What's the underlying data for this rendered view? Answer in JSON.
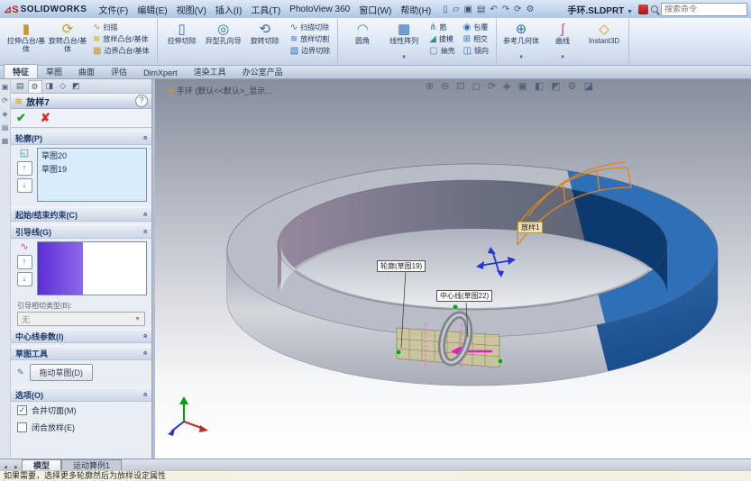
{
  "titlebar": {
    "logo": "SOLIDWORKS",
    "menus": [
      "文件(F)",
      "编辑(E)",
      "视图(V)",
      "插入(I)",
      "工具(T)",
      "PhotoView 360",
      "窗口(W)",
      "帮助(H)"
    ],
    "doc_title": "手环.SLDPRT",
    "search_placeholder": "搜索命令"
  },
  "quick_icons": [
    "▯",
    "▱",
    "▣",
    "▤",
    "↶",
    "↷",
    "⟳",
    "⚙"
  ],
  "ribbon": {
    "extrude_boss": "拉伸凸台/基体",
    "revolve_boss": "旋转凸台/基体",
    "sweep": "扫描",
    "loft": "放样凸台/基体",
    "boundary": "边界凸台/基体",
    "extrude_cut": "拉伸切除",
    "hole_wizard": "异型孔向导",
    "revolve_cut": "旋转切除",
    "sweep_cut": "扫描切除",
    "loft_cut": "放样切割",
    "boundary_cut": "边界切除",
    "fillet": "圆角",
    "linear_pattern": "线性阵列",
    "rib": "筋",
    "draft": "拔模",
    "shell": "抽壳",
    "wrap": "包覆",
    "intersect": "相交",
    "mirror": "镜向",
    "ref_geometry": "参考几何体",
    "curves": "曲线",
    "instant3d": "Instant3D"
  },
  "ribbon_icons": {
    "extrude_boss": "▮",
    "revolve_boss": "⟳",
    "sweep": "∿",
    "loft": "≋",
    "boundary": "▦",
    "extrude_cut": "▯",
    "hole_wizard": "◎",
    "revolve_cut": "⟲",
    "sweep_cut": "∿",
    "loft_cut": "≋",
    "boundary_cut": "▧",
    "fillet": "◠",
    "linear_pattern": "▦",
    "rib": "⋔",
    "draft": "◢",
    "shell": "▢",
    "wrap": "◉",
    "intersect": "⊞",
    "mirror": "◫",
    "ref_geometry": "⊕",
    "curves": "∫",
    "instant3d": "◇"
  },
  "tabs": [
    "特征",
    "草图",
    "曲面",
    "评估",
    "DimXpert",
    "渲染工具",
    "办公室产品"
  ],
  "pm_tab_icons": [
    "▤",
    "⚙",
    "◨",
    "◇",
    "◩"
  ],
  "left_icons": [
    "▣",
    "⟳",
    "◈",
    "▤",
    "▦"
  ],
  "pm": {
    "title": "放样7",
    "help": "?",
    "profiles_header": "轮廓(P)",
    "profiles": [
      "草图20",
      "草图19"
    ],
    "start_end_header": "起始/结束约束(C)",
    "guides_header": "引导线(G)",
    "tangency_label": "引导相切类型(B):",
    "tangency_value": "无",
    "centerline_header": "中心线参数(I)",
    "sketch_tools_header": "草图工具",
    "drag_sketch": "拖动草图(D)",
    "options_header": "选项(O)",
    "merge_faces": "合并切面(M)",
    "close_loft": "闭合放样(E)"
  },
  "viewport": {
    "doc_label": "手环 (默认<<默认>_显示...",
    "callout_loft": "放样1",
    "callout_profile": "轮廓(草图19)",
    "callout_centerline": "中心线(草图22)"
  },
  "view_toolbar": [
    "⊕",
    "⊖",
    "⊡",
    "◻",
    "⟳",
    "◈",
    "▣",
    "◧",
    "◩",
    "⚙",
    "◪"
  ],
  "bottom_tabs": [
    "模型",
    "运动算例1"
  ],
  "status": "如果需要，选择更多轮廓然后为放样设定属性",
  "icons": {
    "check": "✔",
    "cancel": "✘",
    "up": "↑",
    "down": "↓",
    "chevron": "»",
    "dropdown": "▼",
    "small_check": "✓"
  },
  "colors": {
    "band_blue": "#15539e",
    "preview_orange": "#e0821e",
    "magenta": "#e020c0",
    "select_green": "#17a517"
  }
}
